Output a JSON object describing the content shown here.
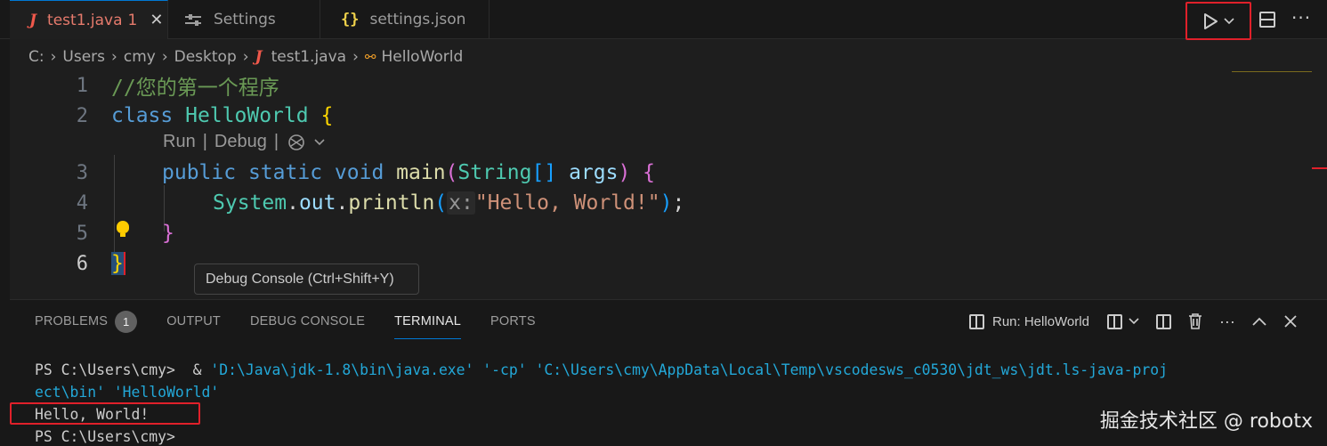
{
  "tabs": [
    {
      "icon": "J",
      "label": "test1.java",
      "badge": "1",
      "close": "✕"
    },
    {
      "label": "Settings"
    },
    {
      "icon": "{}",
      "label": "settings.json"
    }
  ],
  "toolbar": {
    "more": "···"
  },
  "breadcrumb": {
    "drive": "C:",
    "users": "Users",
    "user": "cmy",
    "desktop": "Desktop",
    "file_icon": "J",
    "file": "test1.java",
    "symbol": "HelloWorld"
  },
  "editor": {
    "line_numbers": [
      "1",
      "2",
      "3",
      "4",
      "5",
      "6"
    ],
    "comment": "//您的第一个程序",
    "kw_class": "class",
    "class_name": "HelloWorld",
    "kw_public": "public",
    "kw_static": "static",
    "kw_void": "void",
    "method": "main",
    "type_string": "String",
    "param": "args",
    "sys": "System",
    "out": "out",
    "println": "println",
    "hint": "x:",
    "string_literal": "\"Hello, World!\"",
    "codelens_run": "Run",
    "codelens_sep": "|",
    "codelens_debug": "Debug"
  },
  "tooltip": "Debug Console (Ctrl+Shift+Y)",
  "panel": {
    "tabs": [
      "PROBLEMS",
      "OUTPUT",
      "DEBUG CONSOLE",
      "TERMINAL",
      "PORTS"
    ],
    "problems_count": "1",
    "run_label": "Run: HelloWorld"
  },
  "terminal": {
    "prompt1": "PS C:\\Users\\cmy> ",
    "cmd_amp": " & ",
    "cmd_line1": "'D:\\Java\\jdk-1.8\\bin\\java.exe' '-cp' 'C:\\Users\\cmy\\AppData\\Local\\Temp\\vscodesws_c0530\\jdt_ws\\jdt.ls-java-proj",
    "cmd_line2": "ect\\bin' 'HelloWorld'",
    "output": "Hello, World!",
    "prompt2": "PS C:\\Users\\cmy>"
  },
  "watermark": "掘金技术社区 @ robotx",
  "colors": {
    "accent": "#0078d4",
    "highlight_red": "#e0202a"
  }
}
